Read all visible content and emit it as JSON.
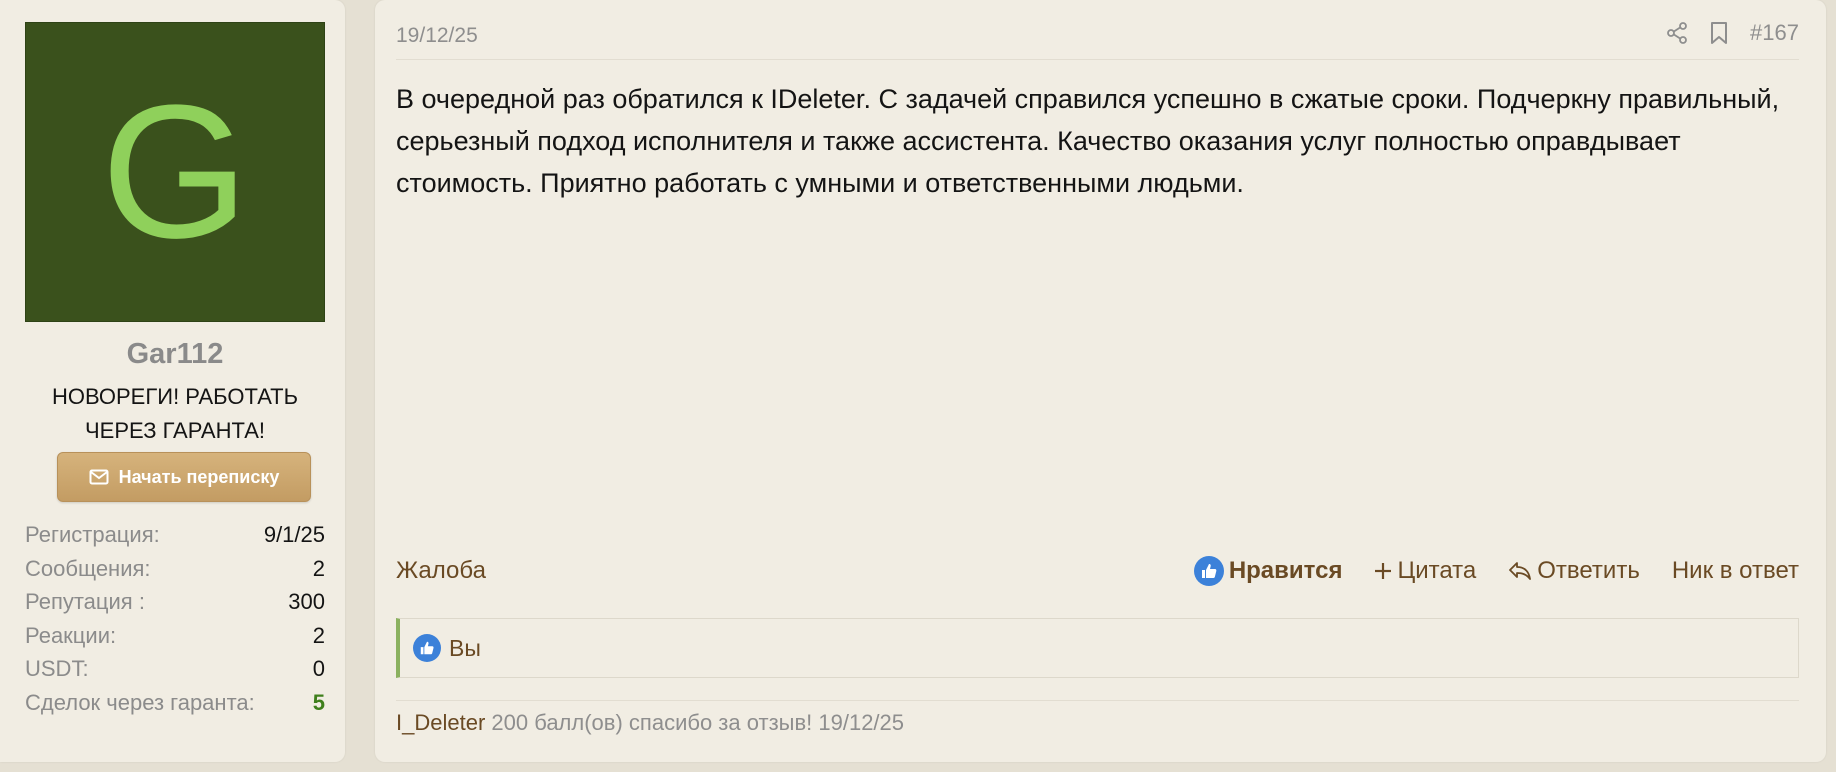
{
  "user": {
    "avatar_letter": "G",
    "avatar_bg": "#3a511c",
    "avatar_fg": "#8fd05b",
    "username": "Gar112",
    "title_line1": "НОВОРЕГИ! РАБОТАТЬ",
    "title_line2": "ЧЕРЕЗ ГАРАНТА!",
    "pm_button": "Начать переписку",
    "pm_icon": "envelope-icon",
    "stats": [
      {
        "label": "Регистрация:",
        "value": "9/1/25"
      },
      {
        "label": "Сообщения:",
        "value": "2"
      },
      {
        "label": "Репутация :",
        "value": "300"
      },
      {
        "label": "Реакции:",
        "value": "2"
      },
      {
        "label": "USDT:",
        "value": "0"
      },
      {
        "label": "Сделок через гаранта:",
        "value": "5",
        "color": "#3f7f1c"
      }
    ]
  },
  "post": {
    "date": "19/12/25",
    "number": "#167",
    "icons": [
      "share-icon",
      "bookmark-icon"
    ],
    "body": "В очередной раз обратился к IDeleter. С задачей справился успешно в сжатые сроки. Подчеркну правильный, серьезный подход исполнителя и также ассистента. Качество оказания услуг полностью оправдывает стоимость. Приятно работать с умными и ответственными людьми.",
    "footer": {
      "report": "Жалоба",
      "like": "Нравится",
      "quote": "Цитата",
      "reply": "Ответить",
      "mention": "Ник в ответ"
    },
    "reactions": {
      "text": "Вы",
      "icon": "thumbs-up-icon"
    },
    "reputation_note": {
      "user": "I_Deleter",
      "text": "200 балл(ов) спасибо за отзыв! 19/12/25"
    }
  },
  "colors": {
    "page_bg": "#e5e0d3",
    "panel_bg": "#f1ede3",
    "link_brown": "#6a4a24",
    "button_gold": "#c39c63",
    "like_blue": "#3c81d9",
    "accent_green": "#8bb15f"
  }
}
